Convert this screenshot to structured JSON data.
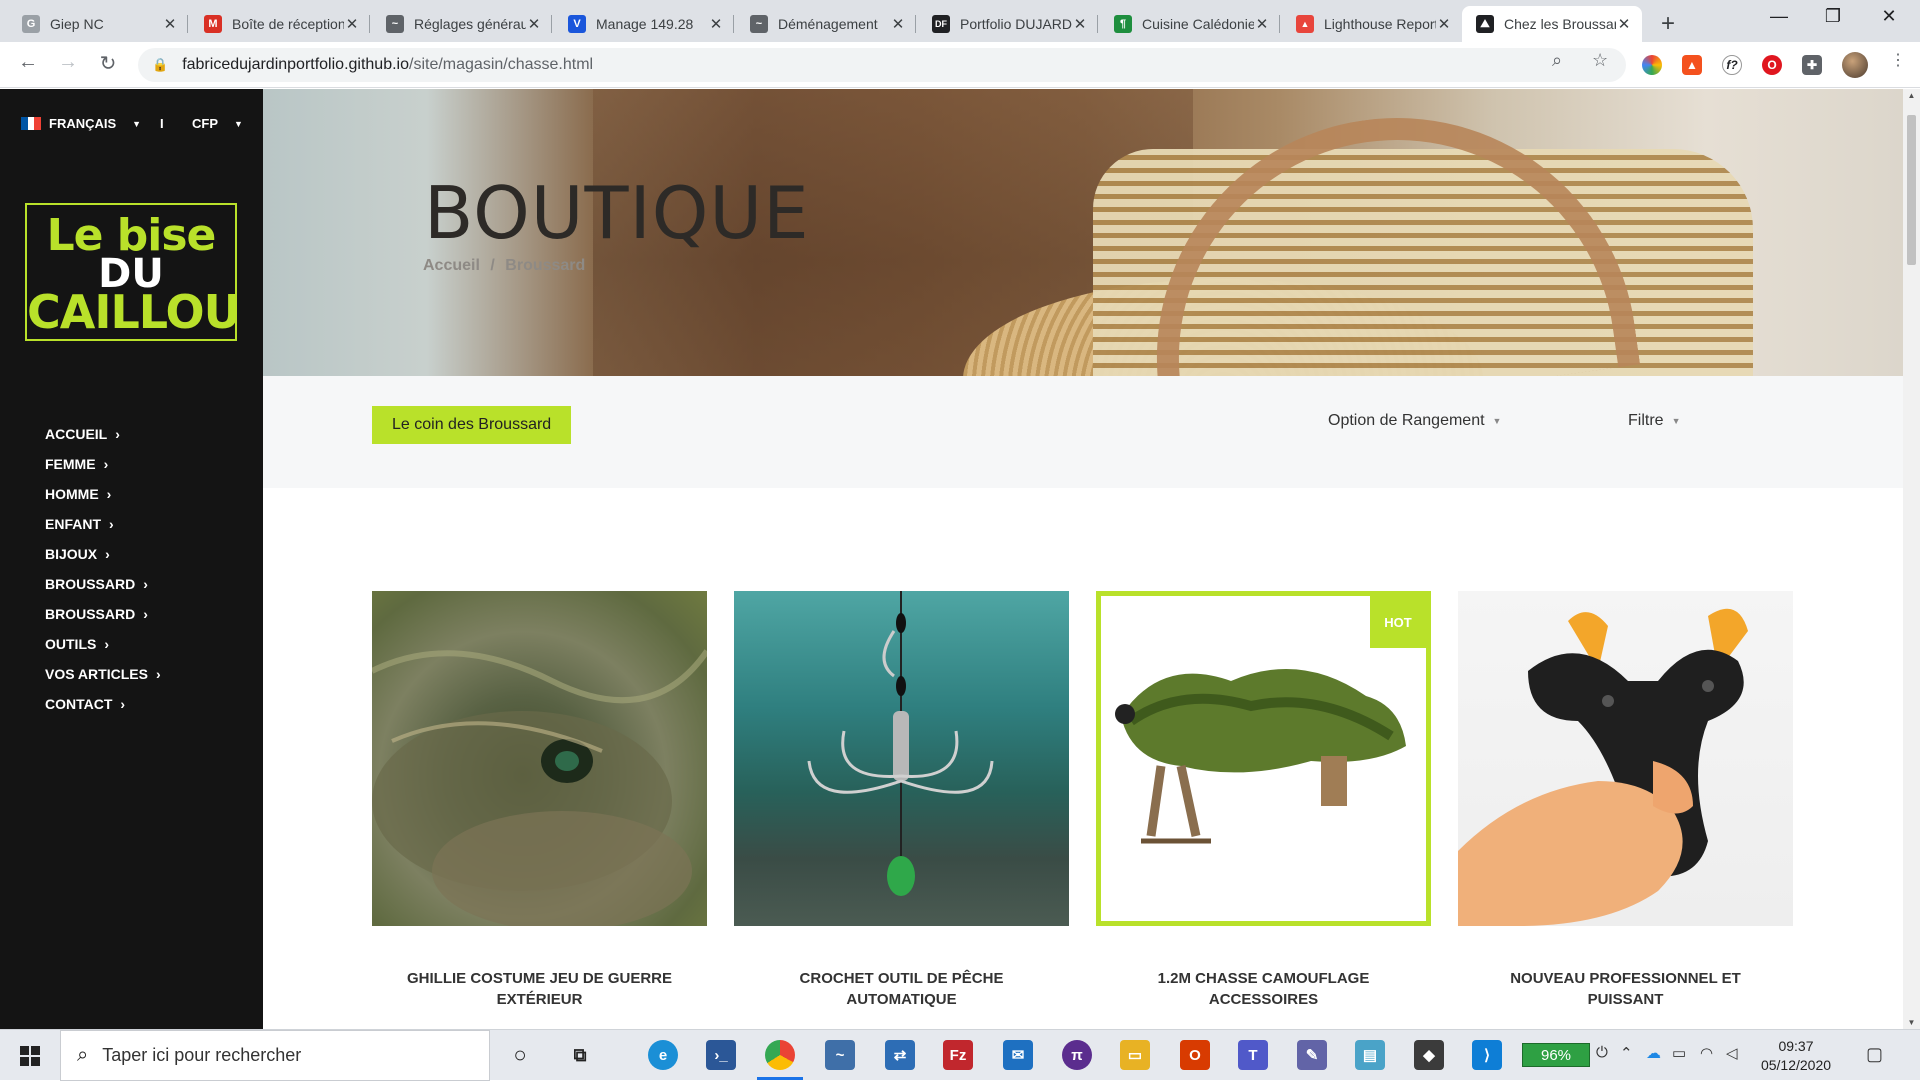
{
  "browser": {
    "tabs": [
      {
        "title": "Giep NC",
        "fav_color": "#9aa0a6",
        "fav_glyph": "G"
      },
      {
        "title": "Boîte de réception",
        "fav_color": "#d93025",
        "fav_glyph": "M"
      },
      {
        "title": "Réglages généraux",
        "fav_color": "#5f6368",
        "fav_glyph": "~"
      },
      {
        "title": "Manage 149.28",
        "fav_color": "#1a56db",
        "fav_glyph": "V"
      },
      {
        "title": "Déménagement",
        "fav_color": "#5f6368",
        "fav_glyph": "~"
      },
      {
        "title": "Portfolio DUJARDIN",
        "fav_color": "#202124",
        "fav_glyph": "DF"
      },
      {
        "title": "Cuisine Calédonienne",
        "fav_color": "#1e8e3e",
        "fav_glyph": "¶"
      },
      {
        "title": "Lighthouse Report",
        "fav_color": "#e8453c",
        "fav_glyph": "▲"
      },
      {
        "title": "Chez les Broussard",
        "fav_color": "#202124",
        "fav_glyph": "⛰"
      }
    ],
    "url_host": "fabricedujardinportfolio.github.io",
    "url_path": "/site/magasin/chasse.html"
  },
  "sidebar": {
    "language": "FRANÇAIS",
    "divider": "I",
    "currency": "CFP",
    "logo": {
      "line1": "Le bise",
      "line2": "DU",
      "line3": "CAILLOU"
    },
    "menu": [
      "ACCUEIL",
      "FEMME",
      "HOMME",
      "ENFANT",
      "BIJOUX",
      "BROUSSARD",
      "BROUSSARD",
      "OUTILS",
      "VOS ARTICLES",
      "CONTACT"
    ]
  },
  "hero": {
    "title": "BOUTIQUE",
    "crumb_home": "Accueil",
    "crumb_sep": "/",
    "crumb_current": "Broussard"
  },
  "toolbar": {
    "category_button": "Le coin des Broussard",
    "sort_label": "Option de Rangement",
    "filter_label": "Filtre"
  },
  "products": [
    {
      "name": "GHILLIE COSTUME JEU DE GUERRE EXTÉRIEUR",
      "hot": false
    },
    {
      "name": "CROCHET OUTIL DE PÊCHE AUTOMATIQUE",
      "hot": false
    },
    {
      "name": "1.2M CHASSE CAMOUFLAGE ACCESSOIRES",
      "hot": true,
      "badge": "HOT"
    },
    {
      "name": "NOUVEAU PROFESSIONNEL ET PUISSANT",
      "hot": false
    }
  ],
  "taskbar": {
    "search_placeholder": "Taper ici pour rechercher",
    "battery": "96%",
    "time": "09:37",
    "date": "05/12/2020"
  },
  "colors": {
    "accent": "#b9e12a",
    "sidebar_bg": "#141414"
  }
}
